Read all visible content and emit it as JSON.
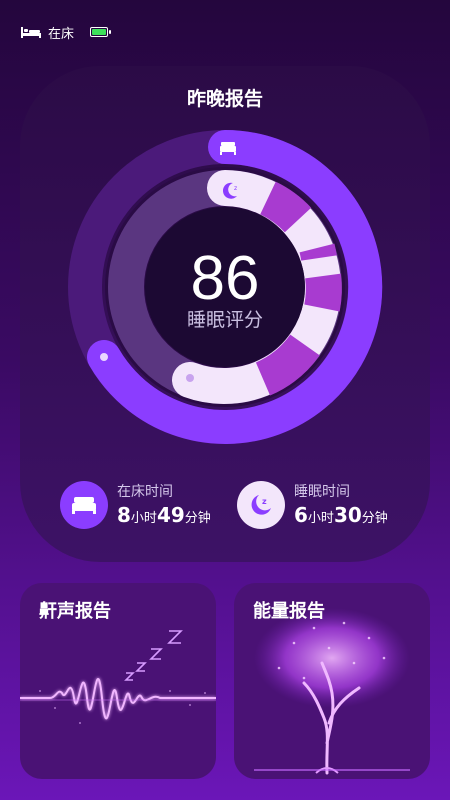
{
  "status_bar": {
    "bed_status": "在床",
    "battery_color": "#3de05a"
  },
  "report": {
    "title": "昨晚报告",
    "score": "86",
    "score_label": "睡眠评分",
    "stats": [
      {
        "label": "在床时间",
        "hours": "8",
        "hour_unit": "小时",
        "minutes": "49",
        "minute_unit": "分钟",
        "icon": "bed-icon"
      },
      {
        "label": "睡眠时间",
        "hours": "6",
        "minute_unit": "分钟",
        "hour_unit": "小时",
        "minutes": "30",
        "icon": "moon-icon"
      }
    ]
  },
  "cards": [
    {
      "title": "鼾声报告",
      "icon": "sound-wave-zzz-illustration"
    },
    {
      "title": "能量报告",
      "icon": "glowing-tree-illustration"
    }
  ],
  "colors": {
    "accent": "#8b3dff",
    "ring_bg": "#4b1a7a",
    "deep_sleep": "#a83bd0",
    "light_sleep": "#f3e6fb"
  }
}
